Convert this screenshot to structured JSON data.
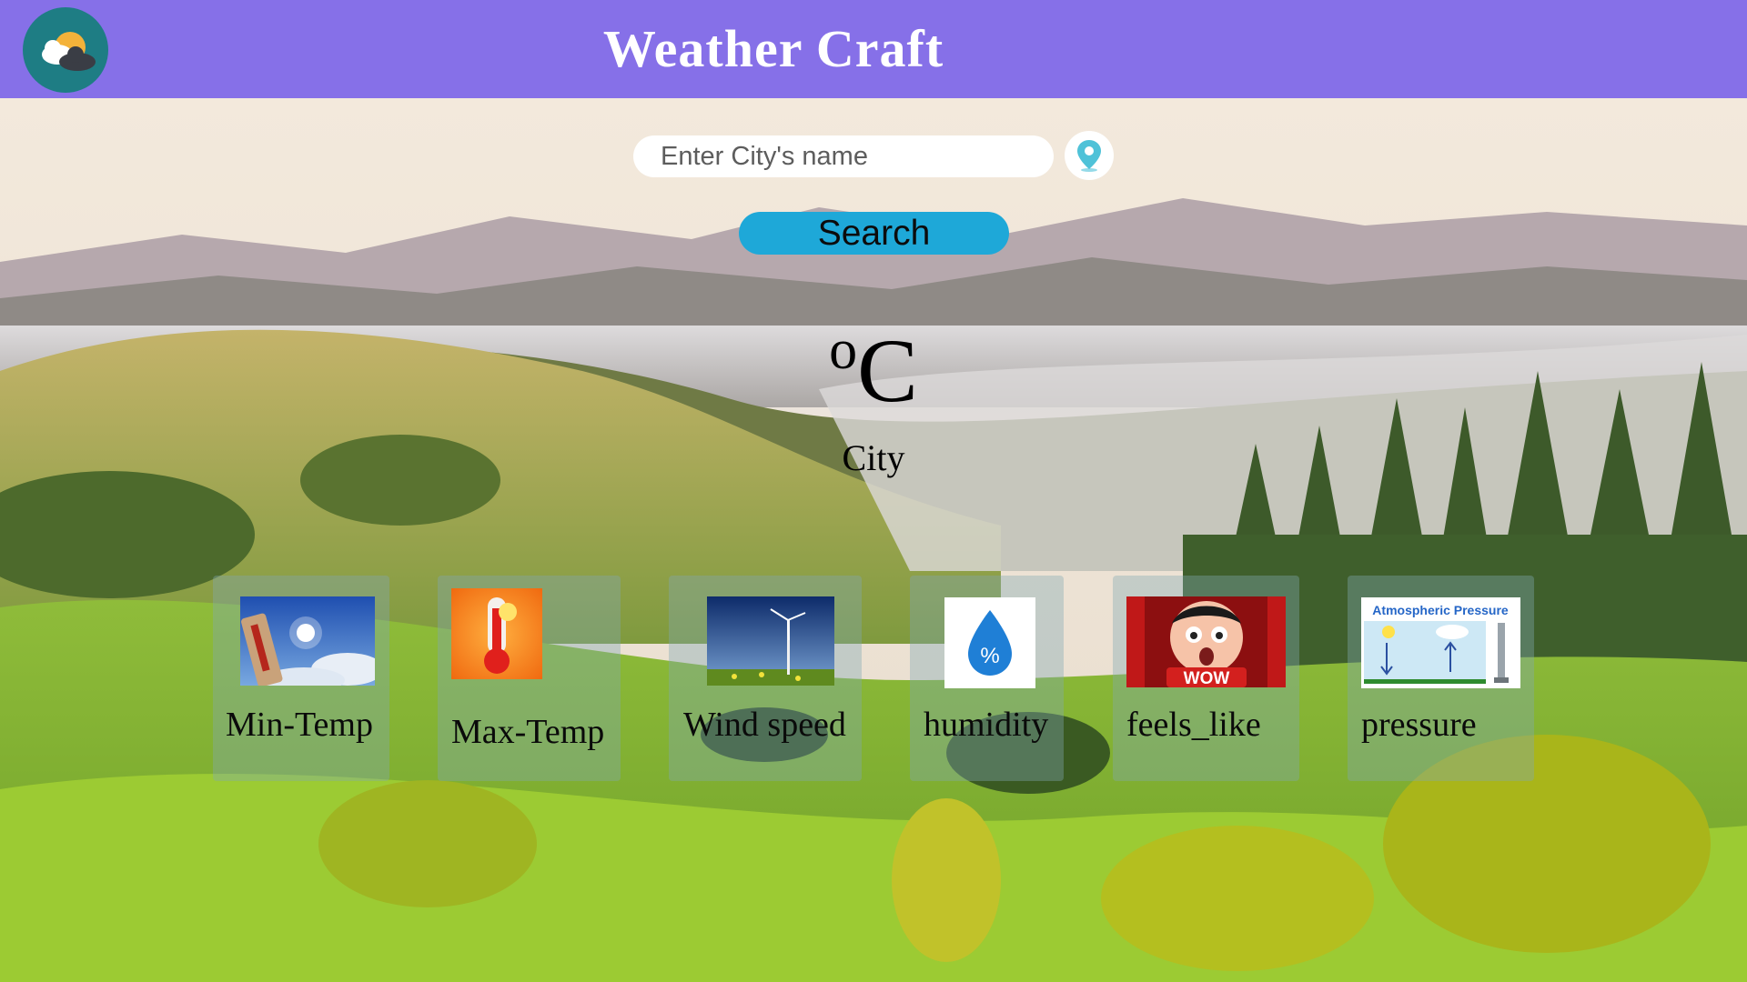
{
  "header": {
    "title": "Weather Craft",
    "logo_icon": "weather-logo-icon",
    "background_color": "#8670e8"
  },
  "search": {
    "placeholder": "Enter City's name",
    "value": "",
    "location_icon": "location-pin-icon",
    "button_label": "Search",
    "button_color": "#1ea8d8"
  },
  "current": {
    "temperature": "",
    "unit_degree": "o",
    "unit_letter": "C",
    "city": "City"
  },
  "metrics": [
    {
      "label": "Min-Temp",
      "icon": "sunny-thermometer-image"
    },
    {
      "label": "Max-Temp",
      "icon": "thermometer-image"
    },
    {
      "label": "Wind speed",
      "icon": "wind-turbine-image"
    },
    {
      "label": "humidity",
      "icon": "humidity-drop-icon",
      "icon_text": "%"
    },
    {
      "label": "feels_like",
      "icon": "wow-face-image",
      "icon_text": "WOW"
    },
    {
      "label": "pressure",
      "icon": "atmospheric-pressure-image",
      "icon_text": "Atmospheric Pressure"
    }
  ]
}
